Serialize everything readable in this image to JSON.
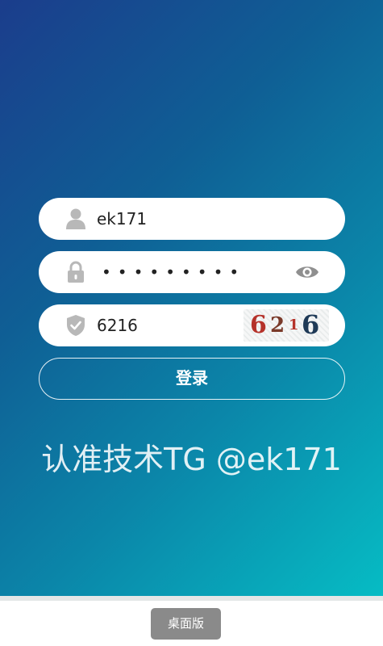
{
  "form": {
    "username": {
      "value": "ek171",
      "icon": "user-icon"
    },
    "password": {
      "masked_value": "•••••••••",
      "icon": "lock-icon",
      "toggle_icon": "eye-icon"
    },
    "captcha": {
      "value": "6216",
      "icon": "shield-check-icon",
      "image_chars": [
        {
          "char": "6",
          "color": "#b5322a"
        },
        {
          "char": "2",
          "color": "#7a3a2a"
        },
        {
          "char": "1",
          "color": "#b5322a"
        },
        {
          "char": "6",
          "color": "#1f3a57"
        }
      ]
    },
    "login_label": "登录"
  },
  "banner": {
    "text": "认准技术TG @ek171"
  },
  "footer": {
    "desktop_label": "桌面版"
  },
  "colors": {
    "gradient_start": "#1b3d8c",
    "gradient_end": "#06bcc4",
    "field_background": "#ffffff",
    "icon_gray": "#b8b8b8",
    "desktop_button": "#8a8a8a"
  }
}
